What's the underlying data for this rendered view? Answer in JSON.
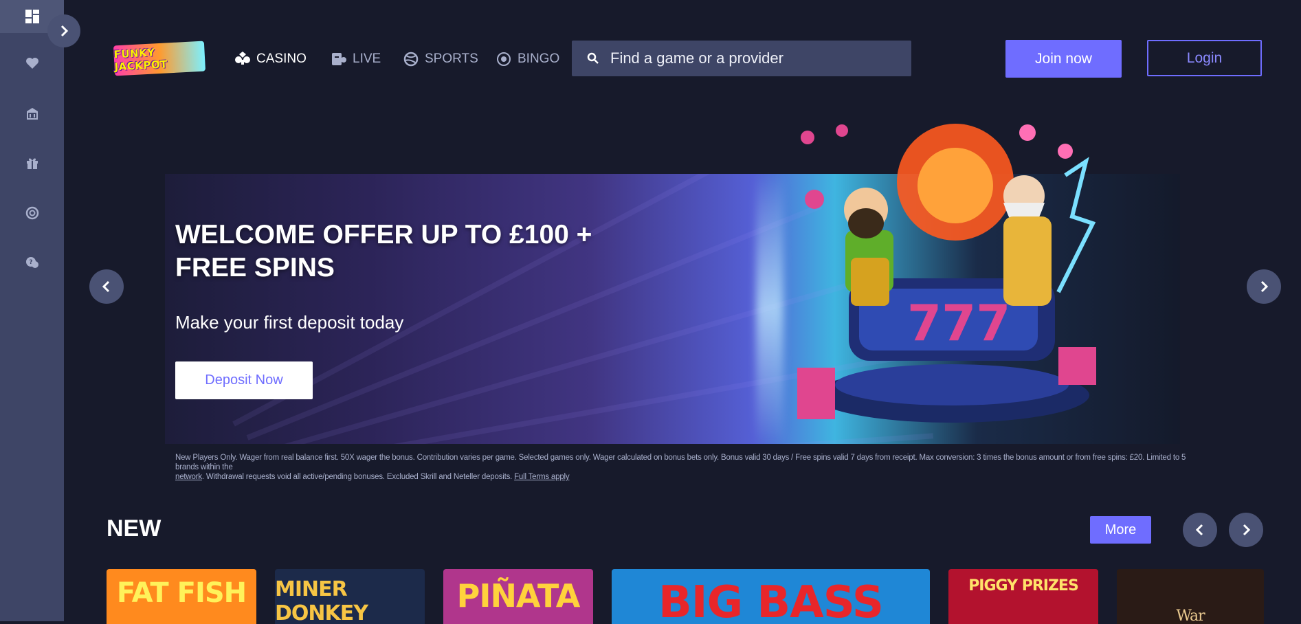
{
  "nav": {
    "items": [
      {
        "label": "CASINO",
        "icon": "cards-icon",
        "active": true
      },
      {
        "label": "LIVE",
        "icon": "live-dealer-icon",
        "active": false
      },
      {
        "label": "SPORTS",
        "icon": "ball-icon",
        "active": false
      },
      {
        "label": "BINGO",
        "icon": "bingo-icon",
        "active": false
      }
    ]
  },
  "logo": {
    "text": "FUNKY JACKPOT"
  },
  "search": {
    "placeholder": "Find a game or a provider"
  },
  "header": {
    "join_label": "Join now",
    "login_label": "Login"
  },
  "sidebar": {
    "items": [
      {
        "icon": "dashboard-icon",
        "active": true
      },
      {
        "icon": "heart-icon"
      },
      {
        "icon": "casino-building-icon"
      },
      {
        "icon": "gift-icon"
      },
      {
        "icon": "target-icon"
      },
      {
        "icon": "support-chat-icon"
      }
    ]
  },
  "banner": {
    "title": "WELCOME OFFER UP TO £100 + FREE SPINS",
    "subtitle": "Make your first deposit today",
    "cta_label": "Deposit Now",
    "terms_text_1": "New Players Only. Wager from real balance first. 50X wager the bonus. Contribution varies per game. Selected games only. Wager calculated on bonus bets only. Bonus valid 30 days / Free spins valid 7 days from receipt. Max conversion: 3 times the bonus amount or from free spins: £20. Limited to 5 brands within the",
    "terms_link_network": "network",
    "terms_text_2": ". Withdrawal requests void all active/pending bonuses. Excluded Skrill and Neteller deposits.",
    "terms_link_full": "Full Terms apply"
  },
  "new_section": {
    "title": "NEW",
    "more_label": "More",
    "games": [
      {
        "label": "FAT FISH",
        "bg": "#ff8a1e",
        "fg": "#fff25a"
      },
      {
        "label": "MINER DONKEY",
        "bg": "#1c2a4a",
        "fg": "#f7c544"
      },
      {
        "label": "PIÑATA",
        "bg": "#b0368c",
        "fg": "#ffd23c"
      },
      {
        "label": "BIG BASS",
        "bg": "#1f87d6",
        "fg": "#e8262a"
      },
      {
        "label": "PIGGY PRIZES",
        "bg": "#b3122e",
        "fg": "#ffe26a"
      },
      {
        "label": "War",
        "bg": "#2a1b16",
        "fg": "#e9c98f"
      }
    ]
  },
  "colors": {
    "accent": "#6f6dff",
    "background": "#171a2b",
    "sidebar": "#3e4566"
  }
}
